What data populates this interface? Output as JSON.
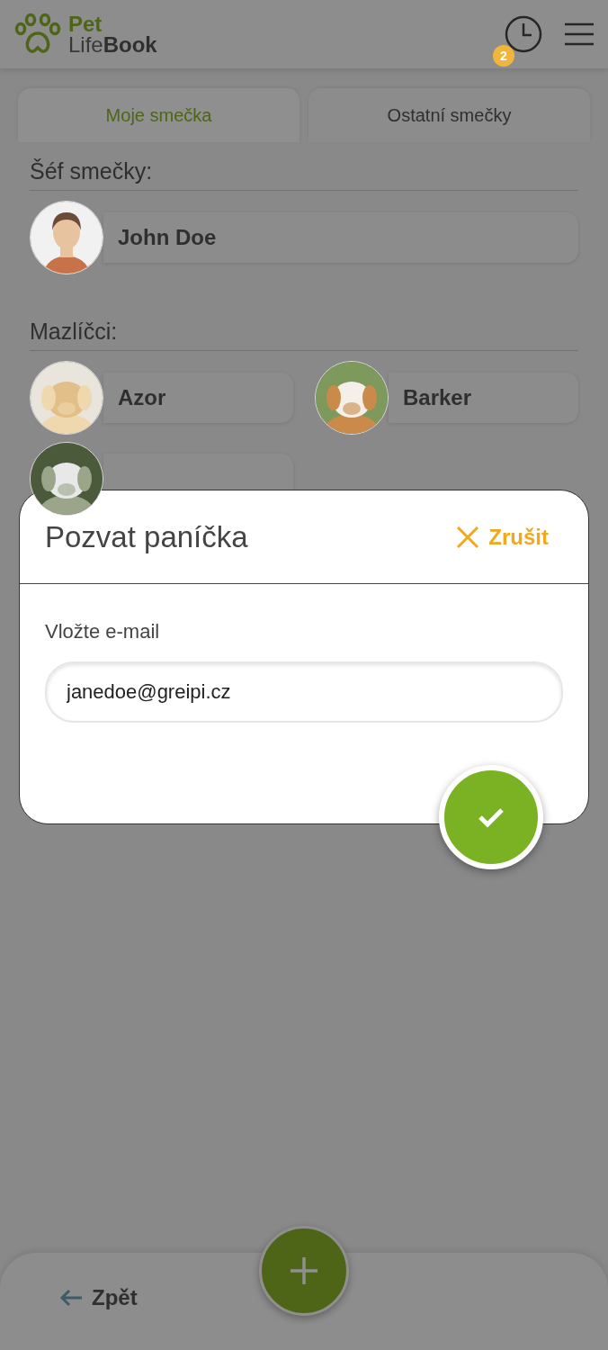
{
  "header": {
    "logo_top": "Pet",
    "logo_bottom": "Life**Book**",
    "history_badge": "2"
  },
  "tabs": [
    {
      "label": "Moje smečka",
      "selected": true
    },
    {
      "label": "Ostatní smečky",
      "selected": false
    }
  ],
  "leader": {
    "heading": "Šéf smečky:",
    "name": "John Doe"
  },
  "pets": {
    "heading": "Mazlíčci:",
    "items": [
      {
        "kind": "named",
        "name": "Azor"
      },
      {
        "kind": "named",
        "name": "Barker"
      },
      {
        "kind": "covered"
      }
    ]
  },
  "dialog": {
    "title": "Pozvat paníčka",
    "cancel": "Zrušit",
    "field_label": "Vložte e-mail",
    "email": "janedoe@greipi.cz"
  },
  "bottom_bar": {
    "back": "Zpět"
  }
}
